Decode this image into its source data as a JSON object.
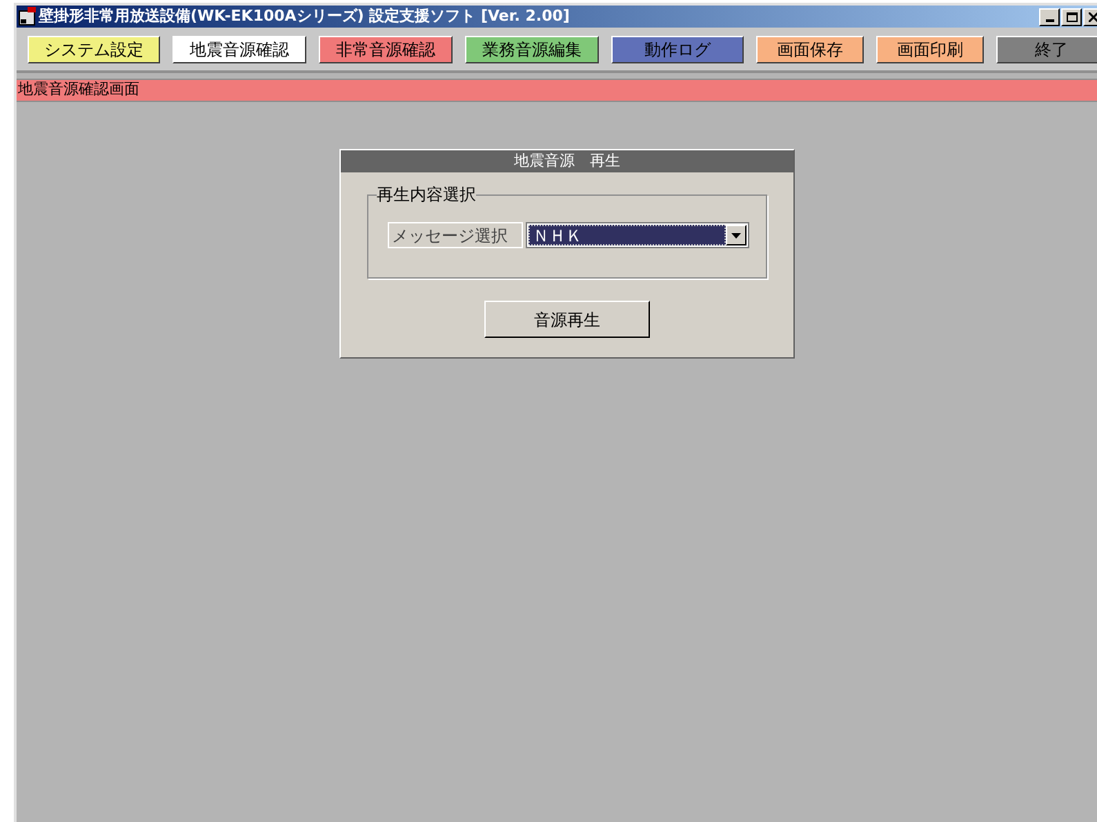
{
  "window": {
    "title": "壁掛形非常用放送設備(WK-EK100Aシリーズ) 設定支援ソフト [Ver. 2.00]"
  },
  "toolbar": [
    {
      "label": "システム設定",
      "color": "#f0f080",
      "selected": false
    },
    {
      "label": "地震音源確認",
      "selected": true
    },
    {
      "label": "非常音源確認",
      "color": "#f07878",
      "selected": false
    },
    {
      "label": "業務音源編集",
      "color": "#80c878",
      "selected": false
    },
    {
      "label": "動作ログ",
      "color": "#6070b8",
      "selected": false
    },
    {
      "label": "画面保存",
      "color": "#f8b080",
      "selected": false
    },
    {
      "label": "画面印刷",
      "color": "#f8b080",
      "selected": false
    },
    {
      "label": "終了",
      "color": "#808080",
      "selected": false
    }
  ],
  "screen_title": "地震音源確認画面",
  "dialog": {
    "title": "地震音源　再生",
    "group": "再生内容選択",
    "field_label": "メッセージ選択",
    "select_value": "ＮＨＫ",
    "button": "音源再生"
  }
}
